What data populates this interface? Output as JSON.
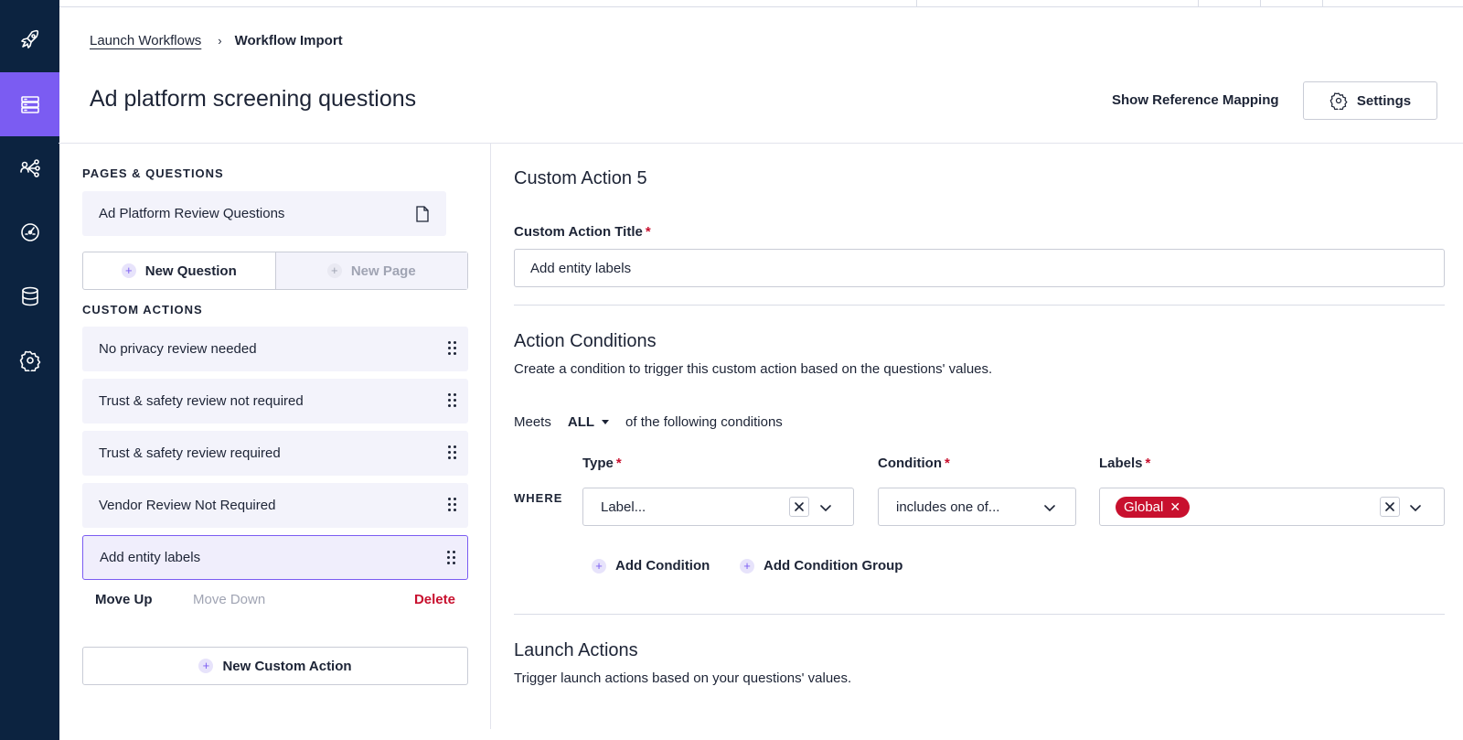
{
  "nav": {
    "items": [
      {
        "icon": "rocket-icon",
        "active": false
      },
      {
        "icon": "server-icon",
        "active": true
      },
      {
        "icon": "share-network-icon",
        "active": false
      },
      {
        "icon": "gauge-icon",
        "active": false
      },
      {
        "icon": "database-icon",
        "active": false
      },
      {
        "icon": "gear-icon",
        "active": false
      }
    ],
    "bg_color": "#0c2340",
    "active_color": "#7b5cf2"
  },
  "breadcrumb": {
    "parent": "Launch Workflows",
    "separator": "›",
    "current": "Workflow Import"
  },
  "header": {
    "title": "Ad platform screening questions",
    "show_reference_label": "Show Reference Mapping",
    "settings_label": "Settings"
  },
  "left": {
    "pages_heading": "PAGES & QUESTIONS",
    "pages": [
      {
        "label": "Ad Platform Review Questions",
        "icon": "file-icon"
      }
    ],
    "new_question_label": "New Question",
    "new_page_label": "New Page",
    "custom_actions_heading": "CUSTOM ACTIONS",
    "custom_actions": [
      {
        "label": "No privacy review needed",
        "selected": false
      },
      {
        "label": "Trust & safety review not required",
        "selected": false
      },
      {
        "label": "Trust & safety review required",
        "selected": false
      },
      {
        "label": "Vendor Review Not Required",
        "selected": false
      },
      {
        "label": "Add entity labels",
        "selected": true
      }
    ],
    "move_up_label": "Move Up",
    "move_down_label": "Move Down",
    "delete_label": "Delete",
    "new_custom_action_label": "New Custom Action"
  },
  "right": {
    "action_heading": "Custom Action 5",
    "title_field": {
      "label": "Custom Action Title",
      "required_mark": "*",
      "value": "Add entity labels"
    },
    "conditions": {
      "heading": "Action Conditions",
      "description": "Create a condition to trigger this custom action based on the questions' values.",
      "meets_label": "Meets",
      "meets_value": "ALL",
      "meets_suffix": "of the following conditions",
      "where_label": "WHERE",
      "type_label": "Type",
      "type_value": "Label...",
      "condition_label": "Condition",
      "condition_value": "includes one of...",
      "labels_label": "Labels",
      "labels_chips": [
        "Global"
      ],
      "required_mark": "*",
      "add_condition_label": "Add Condition",
      "add_condition_group_label": "Add Condition Group"
    },
    "launch": {
      "heading": "Launch Actions",
      "description": "Trigger launch actions based on your questions' values."
    }
  },
  "colors": {
    "accent": "#7b5cf2",
    "danger": "#c8102e",
    "text": "#1d2436"
  }
}
